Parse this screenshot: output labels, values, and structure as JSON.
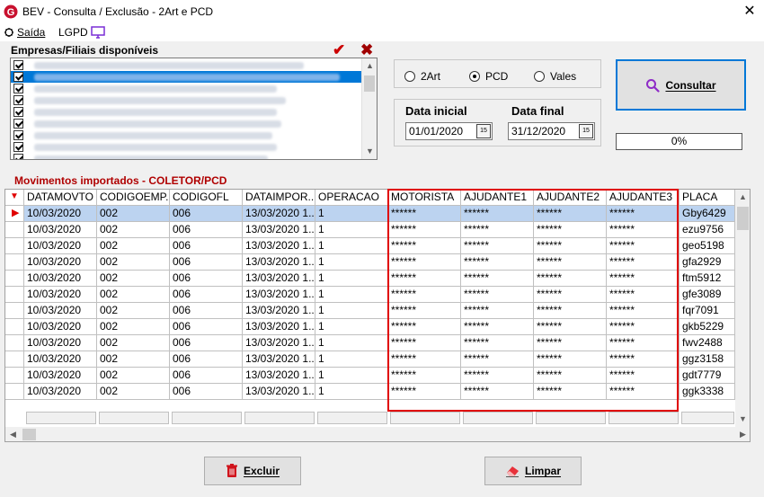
{
  "window": {
    "title": "BEV - Consulta / Exclusão - 2Art e PCD",
    "close_glyph": "✕"
  },
  "menu": {
    "saida": "Saída",
    "lgpd": "LGPD"
  },
  "empresas": {
    "label": "Empresas/Filiais disponíveis",
    "confirm_glyph": "✔",
    "cancel_glyph": "✖"
  },
  "tipo": {
    "options": [
      "2Art",
      "PCD",
      "Vales"
    ],
    "selected": "PCD"
  },
  "datas": {
    "inicial_label": "Data inicial",
    "inicial_value": "01/01/2020",
    "final_label": "Data final",
    "final_value": "31/12/2020",
    "cal_glyph": "15"
  },
  "consultar": {
    "label": "Consultar"
  },
  "progress": {
    "text": "0%",
    "value": 0
  },
  "movimentos": {
    "label": "Movimentos importados - COLETOR/PCD",
    "columns": [
      "DATAMOVTO",
      "CODIGOEMP...",
      "CODIGOFL",
      "DATAIMPOR...",
      "OPERACAO",
      "MOTORISTA",
      "AJUDANTE1",
      "AJUDANTE2",
      "AJUDANTE3",
      "PLACA"
    ],
    "rows": [
      [
        "10/03/2020",
        "002",
        "006",
        "13/03/2020 1...",
        "1",
        "******",
        "******",
        "******",
        "******",
        "Gby6429"
      ],
      [
        "10/03/2020",
        "002",
        "006",
        "13/03/2020 1...",
        "1",
        "******",
        "******",
        "******",
        "******",
        "ezu9756"
      ],
      [
        "10/03/2020",
        "002",
        "006",
        "13/03/2020 1...",
        "1",
        "******",
        "******",
        "******",
        "******",
        "geo5198"
      ],
      [
        "10/03/2020",
        "002",
        "006",
        "13/03/2020 1...",
        "1",
        "******",
        "******",
        "******",
        "******",
        "gfa2929"
      ],
      [
        "10/03/2020",
        "002",
        "006",
        "13/03/2020 1...",
        "1",
        "******",
        "******",
        "******",
        "******",
        "ftm5912"
      ],
      [
        "10/03/2020",
        "002",
        "006",
        "13/03/2020 1...",
        "1",
        "******",
        "******",
        "******",
        "******",
        "gfe3089"
      ],
      [
        "10/03/2020",
        "002",
        "006",
        "13/03/2020 1...",
        "1",
        "******",
        "******",
        "******",
        "******",
        "fqr7091"
      ],
      [
        "10/03/2020",
        "002",
        "006",
        "13/03/2020 1...",
        "1",
        "******",
        "******",
        "******",
        "******",
        "gkb5229"
      ],
      [
        "10/03/2020",
        "002",
        "006",
        "13/03/2020 1...",
        "1",
        "******",
        "******",
        "******",
        "******",
        "fwv2488"
      ],
      [
        "10/03/2020",
        "002",
        "006",
        "13/03/2020 1...",
        "1",
        "******",
        "******",
        "******",
        "******",
        "ggz3158"
      ],
      [
        "10/03/2020",
        "002",
        "006",
        "13/03/2020 1...",
        "1",
        "******",
        "******",
        "******",
        "******",
        "gdt7779"
      ],
      [
        "10/03/2020",
        "002",
        "006",
        "13/03/2020 1...",
        "1",
        "******",
        "******",
        "******",
        "******",
        "ggk3338"
      ]
    ]
  },
  "buttons": {
    "excluir": "Excluir",
    "limpar": "Limpar"
  },
  "colors": {
    "accent_red": "#b00000",
    "highlight": "#e00000",
    "selection": "#0078d7"
  }
}
